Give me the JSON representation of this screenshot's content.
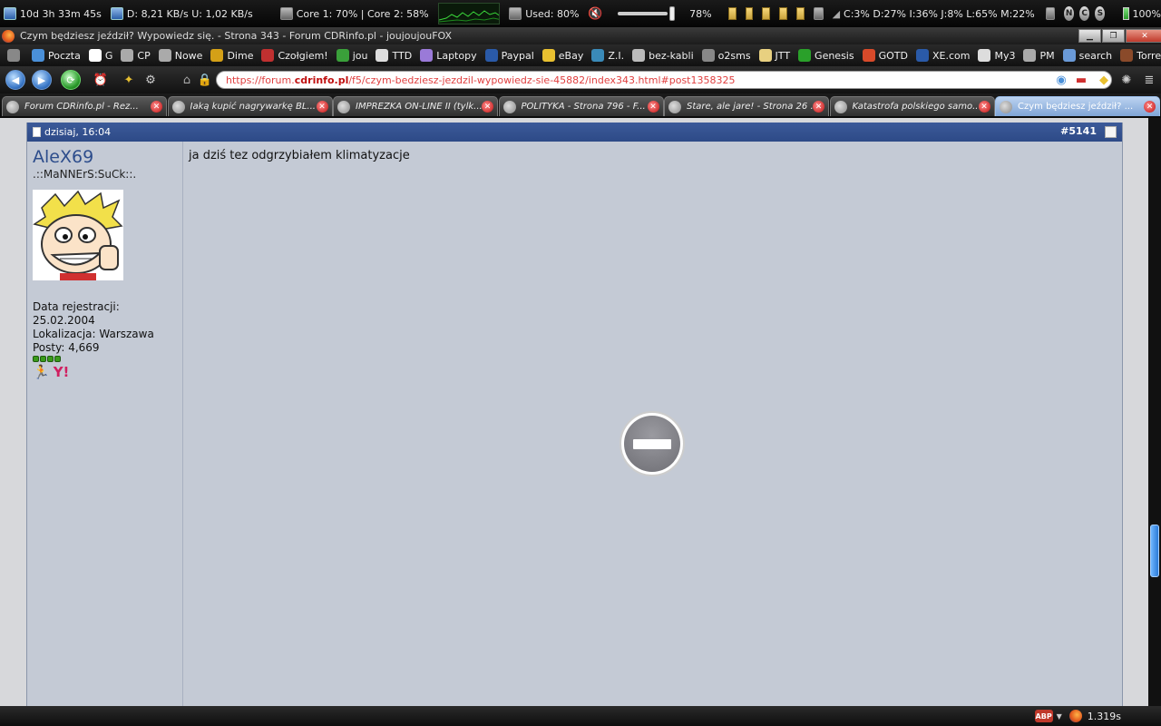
{
  "system_bar": {
    "uptime": "10d 3h 33m 45s",
    "network": "D: 8,21 KB/s U: 1,02 KB/s",
    "cpu": "Core 1: 70% | Core 2: 58%",
    "memory": "Used: 80%",
    "volume_percent": "78%",
    "volume_level": 0.78,
    "drives": "C:3% D:27% I:36% J:8% L:65% M:22%",
    "battery": "100%",
    "tray_letters": [
      "N",
      "C",
      "S"
    ]
  },
  "window": {
    "title": "Czym będziesz jeździł? Wypowiedz się. - Strona 343 - Forum CDRinfo.pl - joujoujouFOX"
  },
  "bookmarks": [
    {
      "label": "Poczta",
      "icon": "mail-icon",
      "color": "#4a90d9"
    },
    {
      "label": "G",
      "icon": "google-icon",
      "color": "#ffffff"
    },
    {
      "label": "CP",
      "icon": "cp-icon",
      "color": "#aaaaaa"
    },
    {
      "label": "Nowe",
      "icon": "new-icon",
      "color": "#aaaaaa"
    },
    {
      "label": "Dime",
      "icon": "dime-icon",
      "color": "#d4a017"
    },
    {
      "label": "Czołgiem!",
      "icon": "tank-icon",
      "color": "#c03030"
    },
    {
      "label": "jou",
      "icon": "jou-icon",
      "color": "#3aa03a"
    },
    {
      "label": "TTD",
      "icon": "ttd-icon",
      "color": "#dddddd"
    },
    {
      "label": "Laptopy",
      "icon": "laptop-icon",
      "color": "#9a7ad8"
    },
    {
      "label": "Paypal",
      "icon": "paypal-icon",
      "color": "#2a5aa8"
    },
    {
      "label": "eBay",
      "icon": "ebay-icon",
      "color": "#e8c030"
    },
    {
      "label": "Z.I.",
      "icon": "zi-icon",
      "color": "#3a8ab8"
    },
    {
      "label": "bez-kabli",
      "icon": "bez-kabli-icon",
      "color": "#bbbbbb"
    },
    {
      "label": "o2sms",
      "icon": "o2sms-icon",
      "color": "#888888"
    },
    {
      "label": "JTT",
      "icon": "jtt-icon",
      "color": "#e8d080"
    },
    {
      "label": "Genesis",
      "icon": "genesis-icon",
      "color": "#2aa02a"
    },
    {
      "label": "GOTD",
      "icon": "gotd-icon",
      "color": "#d84a2a"
    },
    {
      "label": "XE.com",
      "icon": "xe-icon",
      "color": "#2a5aa8"
    },
    {
      "label": "My3",
      "icon": "my3-icon",
      "color": "#dddddd"
    },
    {
      "label": "PM",
      "icon": "pm-icon",
      "color": "#aaaaaa"
    },
    {
      "label": "search",
      "icon": "search-icon",
      "color": "#6a9ad8"
    },
    {
      "label": "TorrentDay",
      "icon": "torrentday-icon",
      "color": "#8a4a2a"
    }
  ],
  "url": {
    "scheme": "https://forum.",
    "host": "cdrinfo.pl",
    "path": "/f5/czym-bedziesz-jezdzil-wypowiedz-sie-45882/index343.html#post1358325"
  },
  "tabs": [
    {
      "title": "Forum CDRinfo.pl - Rez...",
      "active": false
    },
    {
      "title": "Jaką kupić nagrywarkę BL...",
      "active": false
    },
    {
      "title": "IMPREZKA ON-LINE II (tylk...",
      "active": false
    },
    {
      "title": "POLITYKA - Strona 796 - F...",
      "active": false
    },
    {
      "title": "Stare, ale jare! - Strona 26 ...",
      "active": false
    },
    {
      "title": "Katastrofa polskiego samo...",
      "active": false
    },
    {
      "title": "Czym będziesz jeździł? ...",
      "active": true
    }
  ],
  "post": {
    "date": "dzisiaj, 16:04",
    "number": "#5141",
    "username": "AleX69",
    "user_title": ".::MaNNErS:SuCk::.",
    "reg_label": "Data rejestracji:",
    "reg_date": "25.02.2004",
    "location": "Lokalizacja: Warszawa",
    "posts": "Posty: 4,669",
    "content": "ja dziś tez odgrzybiałem klimatyzacje"
  },
  "status_bar": {
    "abp": "ABP",
    "load_time": "1.319s"
  }
}
